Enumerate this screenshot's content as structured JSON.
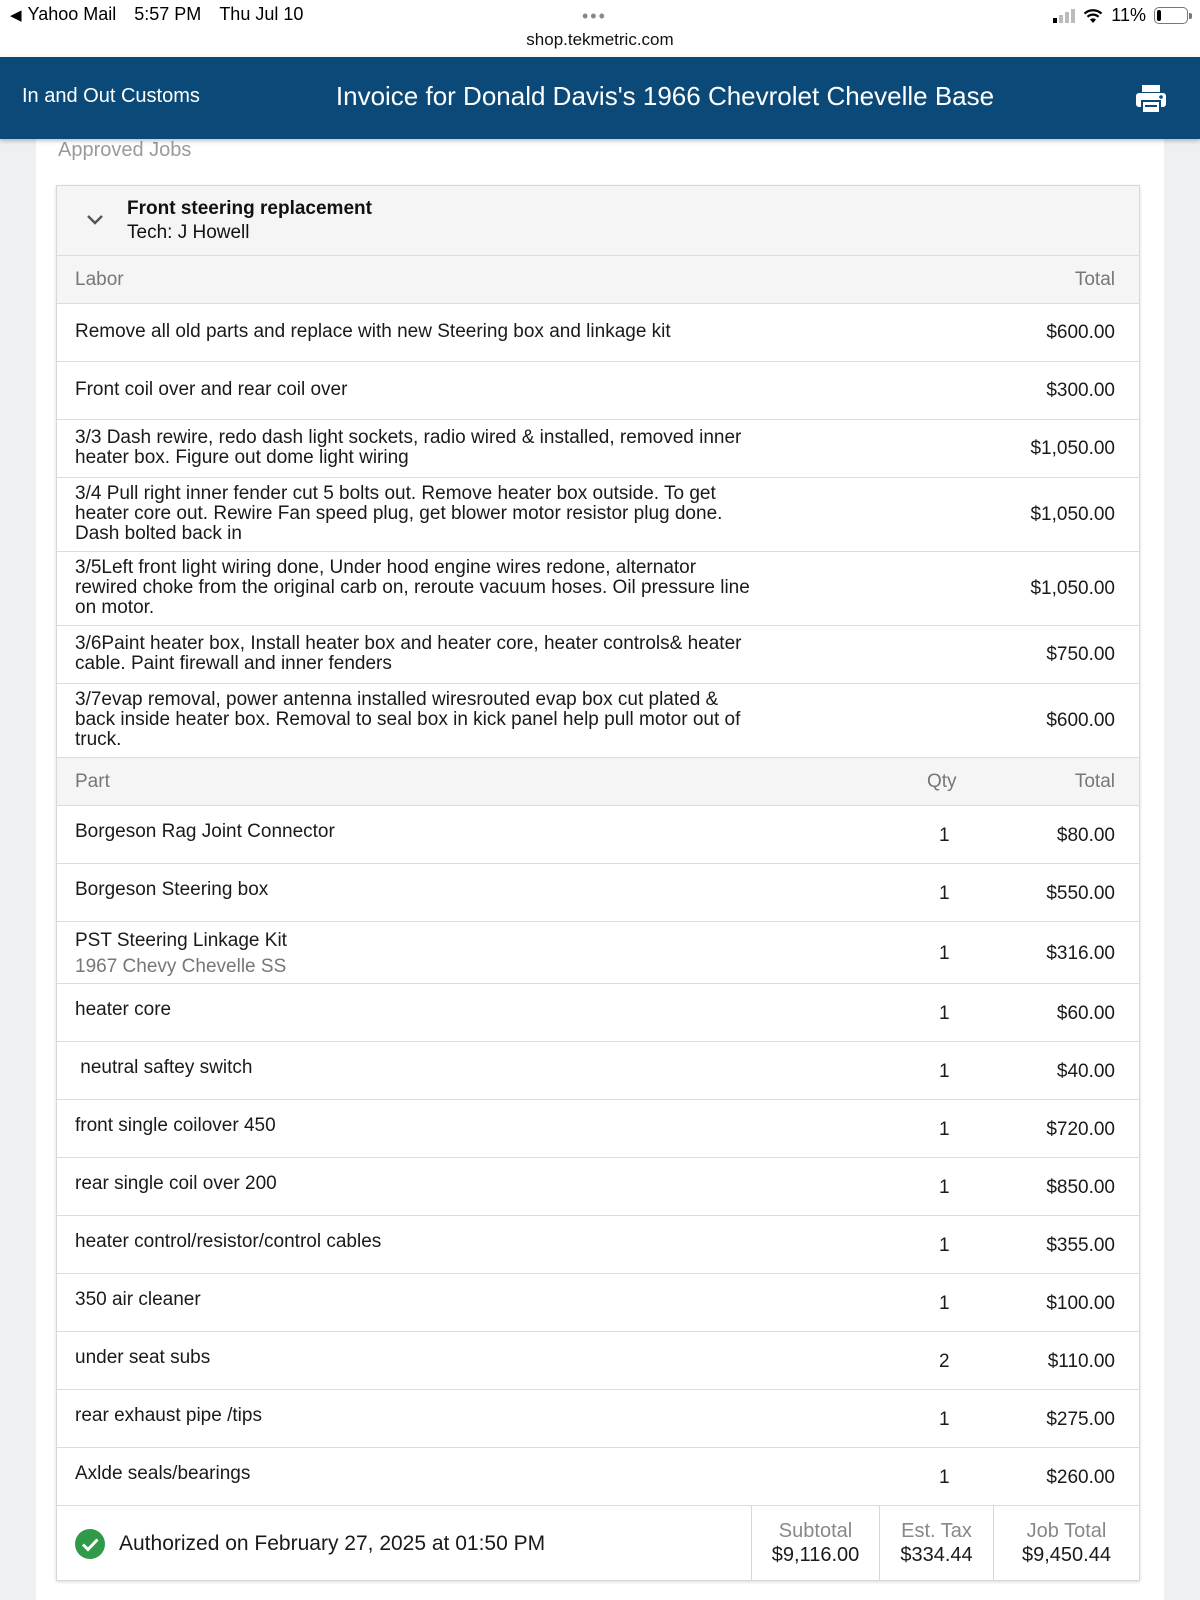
{
  "status_bar": {
    "back_app": "Yahoo Mail",
    "time": "5:57 PM",
    "date": "Thu Jul 10",
    "url": "shop.tekmetric.com",
    "battery": "11%"
  },
  "header": {
    "shop_name": "In and Out Customs",
    "title": "Invoice for Donald Davis's 1966 Chevrolet Chevelle Base",
    "print_icon": "printer-icon"
  },
  "section_label": "Approved Jobs",
  "job": {
    "name": "Front steering replacement",
    "tech": "Tech: J Howell",
    "labor_header": {
      "label": "Labor",
      "total": "Total"
    },
    "labor": [
      {
        "lines": [
          "Remove all old parts and replace with new Steering box and linkage kit"
        ],
        "total": "$600.00"
      },
      {
        "lines": [
          "Front coil over and rear coil over"
        ],
        "total": "$300.00"
      },
      {
        "lines": [
          "3/3 Dash rewire, redo dash light sockets, radio wired & installed, removed inner",
          "heater box. Figure out dome light wiring"
        ],
        "total": "$1,050.00"
      },
      {
        "lines": [
          "3/4 Pull right inner fender cut 5 bolts out. Remove heater box outside. To get",
          "heater core out. Rewire Fan speed plug, get blower motor resistor plug done.",
          "Dash bolted back in"
        ],
        "total": "$1,050.00"
      },
      {
        "lines": [
          "3/5Left front light wiring done, Under hood engine wires redone, alternator",
          "rewired choke from the original carb on, reroute vacuum hoses. Oil pressure line",
          "on motor."
        ],
        "total": "$1,050.00"
      },
      {
        "lines": [
          "3/6Paint heater box, Install heater box and heater core, heater controls& heater",
          "cable. Paint firewall and inner fenders"
        ],
        "total": "$750.00"
      },
      {
        "lines": [
          "3/7evap removal, power antenna installed wiresrouted evap box cut plated &",
          "back inside heater box. Removal to seal box in kick panel help pull motor out of",
          "truck."
        ],
        "total": "$600.00"
      }
    ],
    "parts_header": {
      "label": "Part",
      "qty": "Qty",
      "total": "Total"
    },
    "parts": [
      {
        "name": "Borgeson  Rag Joint Connector",
        "sub": "",
        "qty": "1",
        "total": "$80.00"
      },
      {
        "name": "Borgeson Steering box",
        "sub": "",
        "qty": "1",
        "total": "$550.00"
      },
      {
        "name": "PST Steering Linkage Kit",
        "sub": "1967 Chevy Chevelle SS",
        "qty": "1",
        "total": "$316.00"
      },
      {
        "name": "heater core",
        "sub": "",
        "qty": "1",
        "total": "$60.00"
      },
      {
        "name": " neutral saftey switch",
        "sub": "",
        "qty": "1",
        "total": "$40.00"
      },
      {
        "name": "front single coilover 450",
        "sub": "",
        "qty": "1",
        "total": "$720.00"
      },
      {
        "name": "rear single coil over 200",
        "sub": "",
        "qty": "1",
        "total": "$850.00"
      },
      {
        "name": "heater control/resistor/control cables",
        "sub": "",
        "qty": "1",
        "total": "$355.00"
      },
      {
        "name": "350 air cleaner",
        "sub": "",
        "qty": "1",
        "total": "$100.00"
      },
      {
        "name": "under seat subs",
        "sub": "",
        "qty": "2",
        "total": "$110.00"
      },
      {
        "name": "rear exhaust pipe /tips",
        "sub": "",
        "qty": "1",
        "total": "$275.00"
      },
      {
        "name": "Axlde seals/bearings",
        "sub": "",
        "qty": "1",
        "total": "$260.00"
      }
    ],
    "footer": {
      "authorized": "Authorized on February 27, 2025 at 01:50 PM",
      "subtotal_label": "Subtotal",
      "subtotal": "$9,116.00",
      "tax_label": "Est. Tax",
      "tax": "$334.44",
      "job_total_label": "Job Total",
      "job_total": "$9,450.44"
    }
  },
  "colors": {
    "header_bg": "#0b4a78",
    "check_green": "#2e9a4a"
  }
}
